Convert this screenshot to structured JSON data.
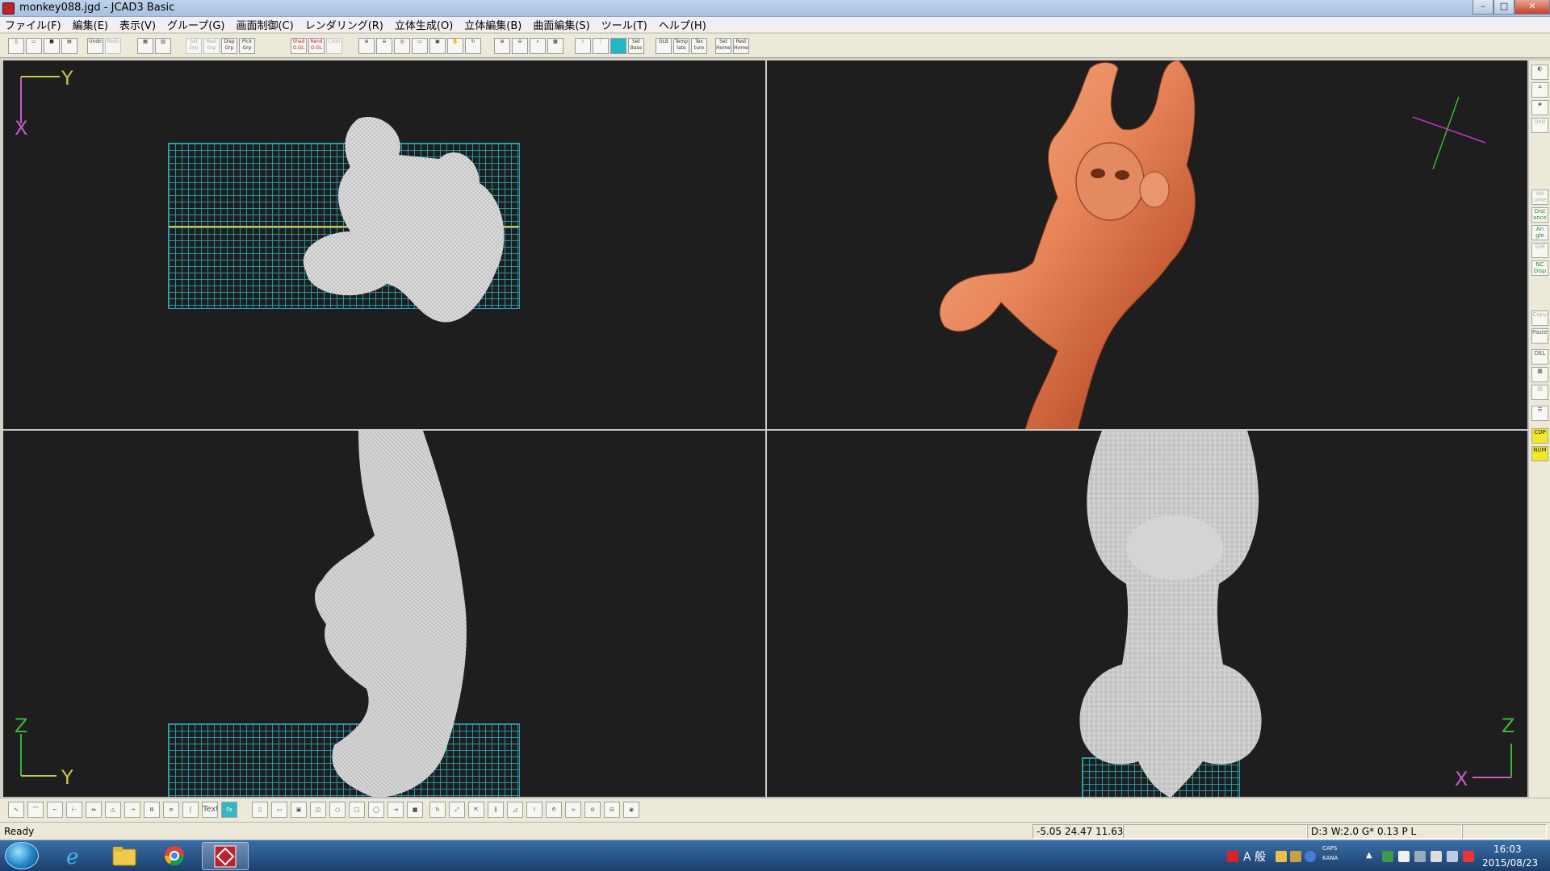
{
  "window": {
    "title": "monkey088.jgd - JCAD3 Basic",
    "minimize": "–",
    "maximize": "□",
    "close": "✕"
  },
  "menu": [
    "ファイル(F)",
    "編集(E)",
    "表示(V)",
    "グループ(G)",
    "画面制御(C)",
    "レンダリング(R)",
    "立体生成(O)",
    "立体編集(B)",
    "曲面編集(S)",
    "ツール(T)",
    "ヘルプ(H)"
  ],
  "toolbar": {
    "undo": "Undo",
    "redo": "Redo",
    "set_grp": "Set Grp",
    "rest_grp": "Rest Grp",
    "disp_grp": "Disp Grp",
    "pick_grp": "Pick Grp",
    "shad_ogl": "Shad O.GL",
    "rend_ogl": "Rend O.GL",
    "color": "Color",
    "glb": "GLB",
    "templ": "Temp late",
    "texture": "Tex ture",
    "set_home": "Set Home",
    "rest_home": "Rest Home",
    "set_base": "Set Base"
  },
  "viewports": {
    "top_left": {
      "axis_h": "Y",
      "axis_v": "X"
    },
    "bottom_left": {
      "axis_v": "Z",
      "axis_h": "Y"
    },
    "bottom_right": {
      "axis_v": "Z",
      "axis_h": "X"
    }
  },
  "side_palette": [
    "Vol ume",
    "Dist ance",
    "An gle",
    "SIM",
    "NC Disp",
    "Copy",
    "Paste",
    "DEL",
    "COP",
    "NUM"
  ],
  "bottom_toolbar": {
    "text_tool": "Text"
  },
  "status": {
    "ready": "Ready",
    "coords": "-5.05 24.47 11.63",
    "grid_info": "D:3 W:2.0 G* 0.13 P  L"
  },
  "taskbar": {
    "time": "16:03",
    "date": "2015/08/23",
    "ime_mode": "A 般",
    "caps": "CAPS",
    "kana": "KANA"
  },
  "colors": {
    "viewport_bg": "#1e1e1e",
    "grid": "#2aa2b0",
    "axis_label": "#c8c84a",
    "axis_x_label": "#c85ac8",
    "render_copper": "#e8865a"
  }
}
